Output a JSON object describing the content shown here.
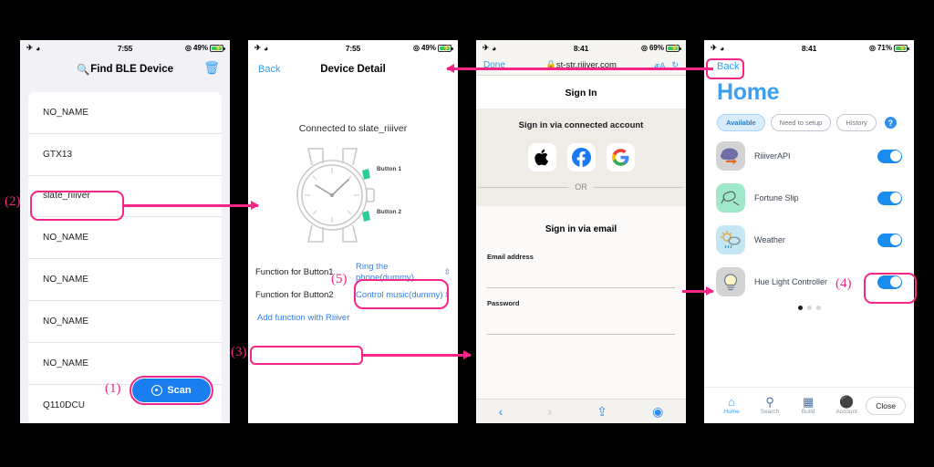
{
  "panels": {
    "ble": {
      "status": {
        "time": "7:55",
        "battery": "49%"
      },
      "title": "Find BLE Device",
      "search_icon": "magnifier-icon",
      "trash_icon": "trash-icon",
      "devices": [
        "NO_NAME",
        "GTX13",
        "slate_riiiver",
        "NO_NAME",
        "NO_NAME",
        "NO_NAME",
        "NO_NAME",
        "Q110DCU"
      ],
      "scan_label": "Scan"
    },
    "detail": {
      "status": {
        "time": "7:55",
        "battery": "49%"
      },
      "back": "Back",
      "title": "Device Detail",
      "connected": "Connected to slate_riiiver",
      "button1_tag": "Button 1",
      "button2_tag": "Button 2",
      "func1_label": "Function for Button1",
      "func1_value": "Ring the phone(dummy)",
      "func2_label": "Function for Button2",
      "func2_value": "Control music(dummy)",
      "add_function": "Add function with Riiiver"
    },
    "signin": {
      "status": {
        "time": "8:41",
        "battery": "69%"
      },
      "done": "Done",
      "url": "st-str.riiiver.com",
      "lock_icon": "lock-icon",
      "aa_icon": "text-size-icon",
      "reload_icon": "reload-icon",
      "page_title": "Sign In",
      "connected_heading": "Sign in via connected account",
      "providers": [
        "apple-icon",
        "facebook-icon",
        "google-icon"
      ],
      "or": "OR",
      "email_heading": "Sign in via email",
      "email_label": "Email address",
      "password_label": "Password",
      "toolbar": [
        "back-icon",
        "forward-icon",
        "share-icon",
        "compass-icon"
      ]
    },
    "home": {
      "status": {
        "time": "8:41",
        "battery": "71%"
      },
      "back": "Back",
      "title": "Home",
      "chips": [
        {
          "label": "Available",
          "active": true
        },
        {
          "label": "Need to setup",
          "active": false
        },
        {
          "label": "History",
          "active": false
        }
      ],
      "help_icon": "help-icon",
      "services": [
        {
          "name": "RiiiverAPI",
          "icon": "cloud-arrow-icon",
          "on": true
        },
        {
          "name": "Fortune Slip",
          "icon": "fortune-stick-icon",
          "on": true
        },
        {
          "name": "Weather",
          "icon": "sun-cloud-rain-icon",
          "on": true
        },
        {
          "name": "Hue Light Controller",
          "icon": "lightbulb-icon",
          "on": true
        }
      ],
      "tabs": [
        {
          "label": "Home",
          "icon": "home-icon",
          "active": true
        },
        {
          "label": "Search",
          "icon": "search-icon",
          "active": false
        },
        {
          "label": "Build",
          "icon": "build-icon",
          "active": false
        },
        {
          "label": "Account",
          "icon": "account-icon",
          "active": false
        }
      ],
      "close_label": "Close"
    }
  },
  "annotations": {
    "accent": "#f72585",
    "markers": [
      "(1)",
      "(2)",
      "(3)",
      "(4)",
      "(5)"
    ]
  }
}
